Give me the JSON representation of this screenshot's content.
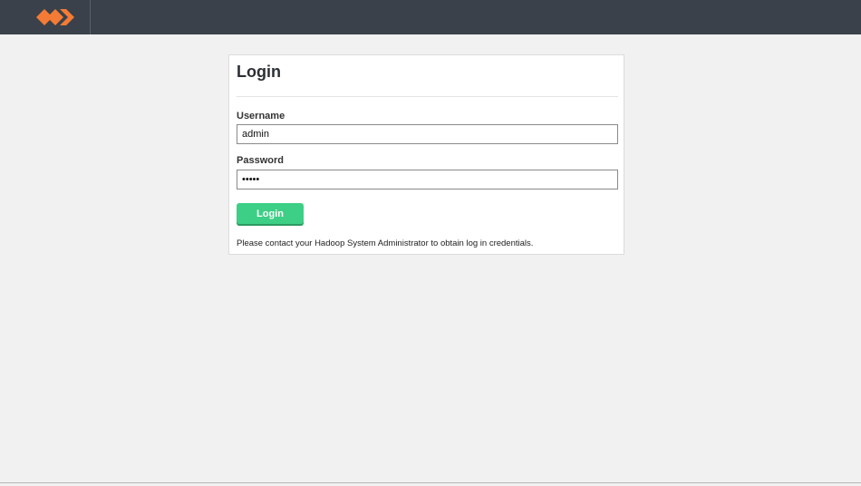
{
  "header": {
    "logo_icon": "orange-diamonds-logo-icon",
    "brand_color": "#f47b35",
    "bar_color": "#3a414a"
  },
  "login": {
    "title": "Login",
    "username_label": "Username",
    "username_value": "admin",
    "password_label": "Password",
    "password_value": "admin",
    "submit_label": "Login",
    "help_text": "Please contact your Hadoop System Administrator to obtain log in credentials.",
    "button_color": "#3dcf85"
  }
}
